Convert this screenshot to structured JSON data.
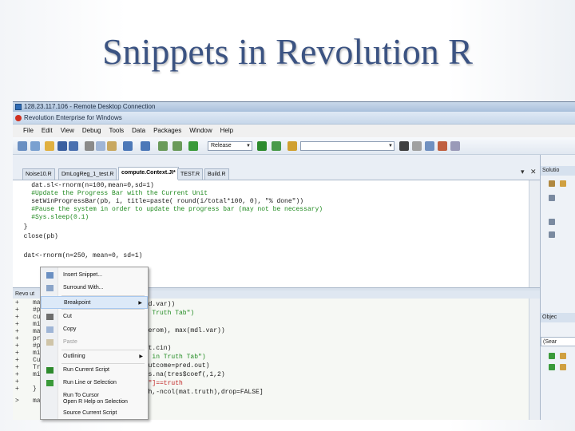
{
  "slide": {
    "title": "Snippets in Revolution R"
  },
  "rdc": {
    "title": "128.23.117.106 - Remote Desktop Connection"
  },
  "app": {
    "title": "Revolution Enterprise for Windows"
  },
  "menu": [
    "File",
    "Edit",
    "View",
    "Debug",
    "Tools",
    "Data",
    "Packages",
    "Window",
    "Help"
  ],
  "toolbar": {
    "config_value": "Release"
  },
  "tabs": [
    {
      "label": "Noise10.R"
    },
    {
      "label": "DmLogReg_1_test.R"
    },
    {
      "label": "compute.Context.JI*",
      "active": true
    },
    {
      "label": "TEST.R"
    },
    {
      "label": "Build.R"
    }
  ],
  "editor_lines": [
    {
      "text": "    dat.sl<-rnorm(n=100,mean=0,sd=1)",
      "kind": "code"
    },
    {
      "text": "    #Update the Progress Bar with the Current Unit",
      "kind": "comment"
    },
    {
      "text": "    setWinProgressBar(pb, i, title=paste( round(i/total*100, 0), \"% done\"))",
      "kind": "code"
    },
    {
      "text": "    #Pause the system in order to update the progress bar (may not be necessary)",
      "kind": "comment"
    },
    {
      "text": "    #Sys.sleep(0.1)",
      "kind": "comment"
    },
    {
      "text": "  }",
      "kind": "code"
    },
    {
      "text": "  close(pb)",
      "kind": "code"
    },
    {
      "text": "",
      "kind": "code"
    },
    {
      "text": "  dat<-rnorm(n=250, mean=0, sd=1)",
      "kind": "code"
    }
  ],
  "lower": {
    "header": "Revo ut",
    "left_lines": [
      {
        "pm": "+",
        "text": "mat"
      },
      {
        "pm": "+",
        "text": "#p"
      },
      {
        "pm": "+",
        "text": "cu"
      },
      {
        "pm": "+",
        "text": "mi"
      },
      {
        "pm": "+",
        "text": "ma"
      },
      {
        "pm": "+",
        "text": "pr"
      },
      {
        "pm": "+",
        "text": "#p"
      },
      {
        "pm": "+",
        "text": "mi"
      },
      {
        "pm": "+",
        "text": "Cu"
      },
      {
        "pm": "+",
        "text": "Tr"
      },
      {
        "pm": "+",
        "text": "mi"
      },
      {
        "pm": "+",
        "text": ""
      },
      {
        "pm": "+",
        "text": "}"
      },
      {
        "pm": ">",
        "text": "mat"
      }
    ],
    "right_lines": [
      {
        "text": "ncd.var))",
        "kind": "code"
      },
      {
        "text": "in Truth Tab\")",
        "kind": "comment"
      },
      {
        "text": "",
        "kind": "code"
      },
      {
        "text": ",jerom), max(mdl.var))",
        "kind": "code"
      },
      {
        "text": "s",
        "kind": "code"
      },
      {
        "text": "mat.cin)",
        "kind": "code"
      },
      {
        "text": "so in Truth Tab\")",
        "kind": "comment"
      },
      {
        "text": " outcome=pred.out)",
        "kind": "code"
      },
      {
        "text": " is.na(tres$coef(,1,2)",
        "kind": "code"
      },
      {
        "text": "ne\"]==truth",
        "kind": "code"
      },
      {
        "text": "uth,-ncol(mat.truth),drop=FALSE]",
        "kind": "code"
      }
    ]
  },
  "right_panel": {
    "solution_label": "Solutio",
    "object_label": "Objec",
    "search_label": "(Sear"
  },
  "context_menu": [
    {
      "label": "Insert Snippet...",
      "icon": "insert-snippet-icon"
    },
    {
      "label": "Surround With...",
      "icon": "surround-icon"
    },
    {
      "label": "Breakpoint",
      "submenu": true,
      "highlight": true
    },
    {
      "label": "Cut",
      "icon": "cut-icon"
    },
    {
      "label": "Copy",
      "icon": "copy-icon"
    },
    {
      "label": "Paste",
      "icon": "paste-icon",
      "disabled": true
    },
    {
      "label": "Outlining",
      "submenu": true
    },
    {
      "label": "Run Current Script",
      "icon": "run-script-icon"
    },
    {
      "label": "Run Line or Selection",
      "icon": "run-line-icon"
    },
    {
      "label": "Run To Cursor"
    },
    {
      "label": "Open R Help on Selection"
    },
    {
      "label": "Source Current Script"
    }
  ]
}
